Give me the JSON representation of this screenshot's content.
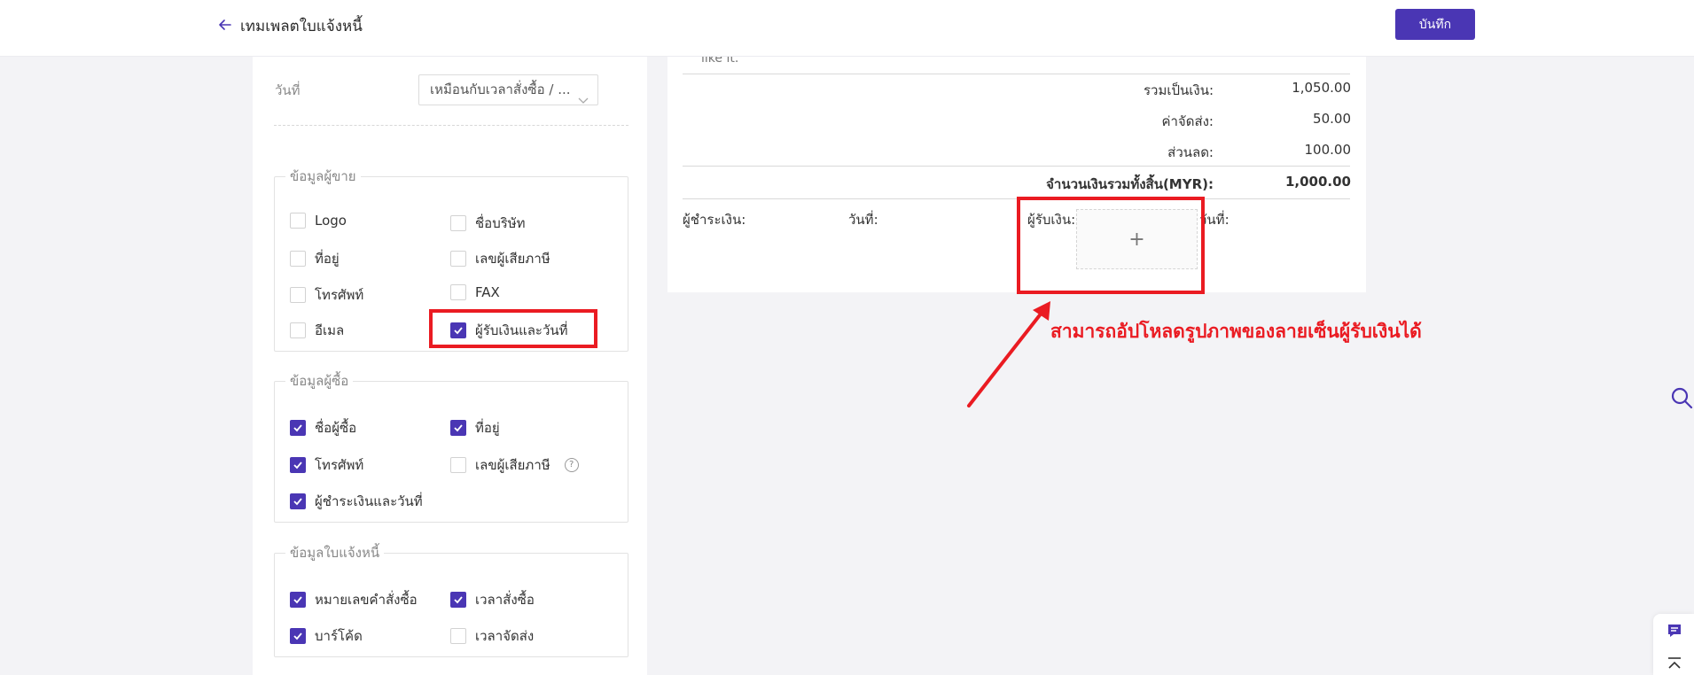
{
  "header": {
    "title": "เทมเพลตใบแจ้งหนี้",
    "save_label": "บันทึก"
  },
  "settings": {
    "date_label": "วันที่",
    "date_select_value": "เหมือนกับเวลาสั่งซื้อ / ...",
    "seller_group": {
      "legend": "ข้อมูลผู้ขาย",
      "options": [
        {
          "label": "Logo",
          "checked": false
        },
        {
          "label": "ชื่อบริษัท",
          "checked": false
        },
        {
          "label": "ที่อยู่",
          "checked": false
        },
        {
          "label": "เลขผู้เสียภาษี",
          "checked": false
        },
        {
          "label": "โทรศัพท์",
          "checked": false
        },
        {
          "label": "FAX",
          "checked": false
        },
        {
          "label": "อีเมล",
          "checked": false
        },
        {
          "label": "ผู้รับเงินและวันที่",
          "checked": true
        }
      ]
    },
    "buyer_group": {
      "legend": "ข้อมูลผู้ซื้อ",
      "options": [
        {
          "label": "ชื่อผู้ซื้อ",
          "checked": true
        },
        {
          "label": "ที่อยู่",
          "checked": true
        },
        {
          "label": "โทรศัพท์",
          "checked": true
        },
        {
          "label": "เลขผู้เสียภาษี",
          "checked": false
        },
        {
          "label": "ผู้ชำระเงินและวันที่",
          "checked": true
        }
      ],
      "help_icon": "?"
    },
    "invoice_group": {
      "legend": "ข้อมูลใบแจ้งหนี้",
      "options": [
        {
          "label": "หมายเลขคำสั่งซื้อ",
          "checked": true
        },
        {
          "label": "เวลาสั่งซื้อ",
          "checked": true
        },
        {
          "label": "บาร์โค้ด",
          "checked": true
        },
        {
          "label": "เวลาจัดส่ง",
          "checked": false
        }
      ]
    }
  },
  "preview": {
    "cut_text": "like it.",
    "summary": [
      {
        "label": "รวมเป็นเงิน:",
        "value": "1,050.00"
      },
      {
        "label": "ค่าจัดส่ง:",
        "value": "50.00"
      },
      {
        "label": "ส่วนลด:",
        "value": "100.00"
      }
    ],
    "total_label": "จำนวนเงินรวมทั้งสิ้น(MYR):",
    "total_value": "1,000.00",
    "payer_label": "ผู้ชำระเงิน:",
    "payer_date_label": "วันที่:",
    "receiver_label": "ผู้รับเงิน:",
    "receiver_date_label": "วันที่:",
    "upload_symbol": "+"
  },
  "annotation": {
    "text": "สามารถอัปโหลดรูปภาพของลายเซ็นผู้รับเงินได้",
    "color": "#ea1b22"
  },
  "colors": {
    "accent": "#4a36b4",
    "highlight": "#ea1b22"
  },
  "icons": [
    "arrow-left-icon",
    "chevron-down-icon",
    "check-icon",
    "help-icon",
    "plus-icon",
    "search-icon",
    "chat-icon",
    "back-to-top-icon"
  ]
}
